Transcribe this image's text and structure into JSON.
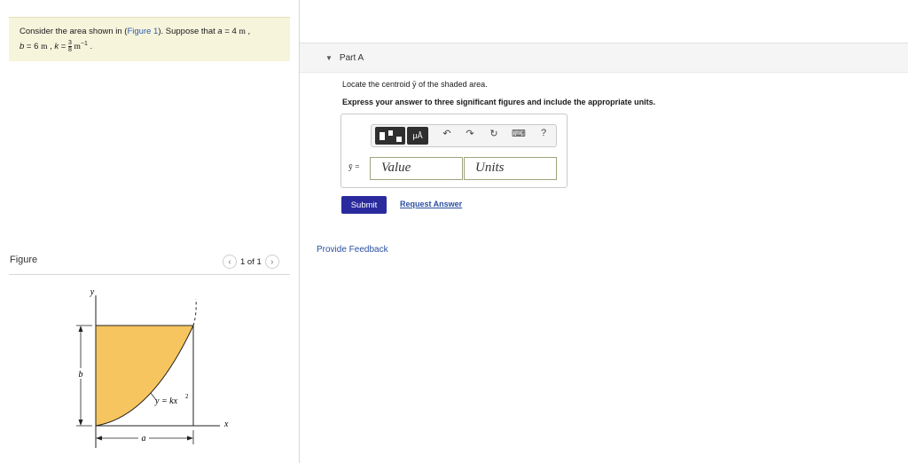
{
  "problem": {
    "intro": "Consider the area shown in (",
    "figure_link": "Figure 1",
    "mid": "). Suppose that ",
    "a_var": "a",
    "a_eq": " = 4",
    "a_unit": "m",
    "b_var": "b",
    "b_eq": " = 6",
    "b_unit": "m",
    "k_var": "k",
    "k_num": "3",
    "k_den": "8",
    "k_unit": "m",
    "k_exp": "−1"
  },
  "figure": {
    "label": "Figure",
    "counter": "1 of 1",
    "prev": "‹",
    "next": "›",
    "axis_y": "y",
    "axis_x": "x",
    "dim_b": "b",
    "dim_a": "a",
    "curve_label": "y = kx",
    "curve_exp": "2"
  },
  "part_a": {
    "title": "Part A",
    "prompt": "Locate the centroid ȳ of the shaded area.",
    "instruction": "Express your answer to three significant figures and include the appropriate units.",
    "answer_label": "ȳ =",
    "value_placeholder": "Value",
    "units_placeholder": "Units",
    "submit": "Submit",
    "request_answer": "Request Answer"
  },
  "toolbar": {
    "mu_label": "μÅ",
    "undo_icon": "↶",
    "redo_icon": "↷",
    "reset_icon": "↻",
    "keyboard_icon": "⌨",
    "help_icon": "?"
  },
  "footer": {
    "feedback": "Provide Feedback"
  },
  "colors": {
    "shaded_area": "#f7c55f",
    "problem_bg": "#f7f4dc",
    "submit_bg": "#2a2a9e",
    "link": "#2a4fa0"
  }
}
